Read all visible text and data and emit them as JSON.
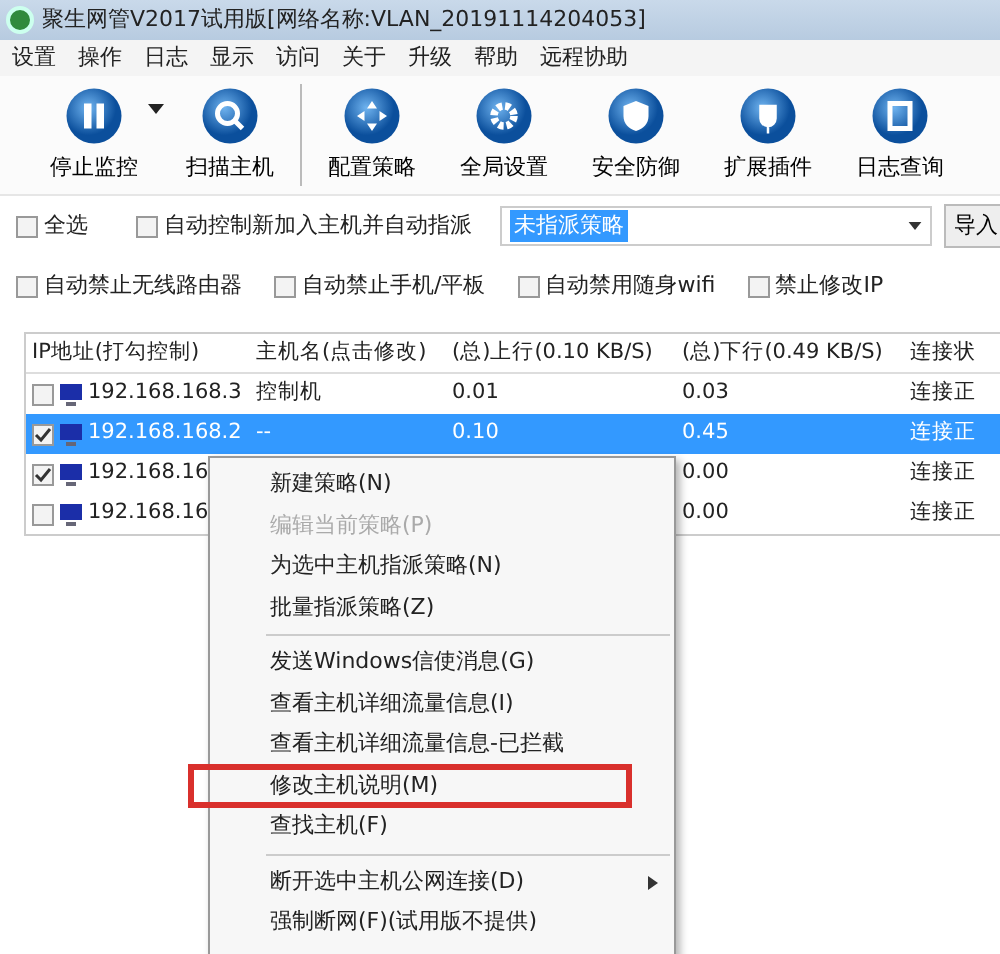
{
  "window": {
    "title": "聚生网管V2017试用版[网络名称:VLAN_20191114204053]"
  },
  "menu_bar": [
    "设置",
    "操作",
    "日志",
    "显示",
    "访问",
    "关于",
    "升级",
    "帮助",
    "远程协助"
  ],
  "toolbar": [
    {
      "label": "停止监控",
      "kind": "pause",
      "dropdown": true
    },
    {
      "label": "扫描主机",
      "kind": "search",
      "dropdown": false
    },
    {
      "label": "配置策略",
      "kind": "arrows",
      "dropdown": false
    },
    {
      "label": "全局设置",
      "kind": "gear",
      "dropdown": false
    },
    {
      "label": "安全防御",
      "kind": "shield",
      "dropdown": false
    },
    {
      "label": "扩展插件",
      "kind": "plug",
      "dropdown": false
    },
    {
      "label": "日志查询",
      "kind": "doc",
      "dropdown": false
    }
  ],
  "options_row_1": {
    "select_all": {
      "label": "全选",
      "checked": false
    },
    "auto_control": {
      "label": "自动控制新加入主机并自动指派",
      "checked": false
    },
    "policy_select": {
      "value": "未指派策略"
    },
    "import_button": "导入"
  },
  "options_row_2": [
    {
      "label": "自动禁止无线路由器",
      "checked": false
    },
    {
      "label": "自动禁止手机/平板",
      "checked": false
    },
    {
      "label": "自动禁用随身wifi",
      "checked": false
    },
    {
      "label": "禁止修改IP",
      "checked": false
    }
  ],
  "table": {
    "columns": [
      "IP地址(打勾控制)",
      "主机名(点击修改)",
      "(总)上行(0.10 KB/S)",
      "(总)下行(0.49 KB/S)",
      "连接状"
    ],
    "rows": [
      {
        "checked": false,
        "selected": false,
        "ip": "192.168.168.3",
        "host": "控制机",
        "up": "0.01",
        "down": "0.03",
        "status": "连接正"
      },
      {
        "checked": true,
        "selected": true,
        "ip": "192.168.168.2",
        "host": "--",
        "up": "0.10",
        "down": "0.45",
        "status": "连接正"
      },
      {
        "checked": true,
        "selected": false,
        "ip": "192.168.16",
        "down": "0.00",
        "status": "连接正"
      },
      {
        "checked": false,
        "selected": false,
        "ip": "192.168.16",
        "down": "0.00",
        "status": "连接正"
      }
    ]
  },
  "context_menu": [
    {
      "kind": "item",
      "label": "新建策略(N)",
      "disabled": false,
      "highlighted": false,
      "submenu": false
    },
    {
      "kind": "item",
      "label": "编辑当前策略(P)",
      "disabled": true,
      "highlighted": false,
      "submenu": false
    },
    {
      "kind": "item",
      "label": "为选中主机指派策略(N)",
      "disabled": false,
      "highlighted": false,
      "submenu": false
    },
    {
      "kind": "item",
      "label": "批量指派策略(Z)",
      "disabled": false,
      "highlighted": false,
      "submenu": false
    },
    {
      "kind": "separator"
    },
    {
      "kind": "item",
      "label": "发送Windows信使消息(G)",
      "disabled": false,
      "highlighted": false,
      "submenu": false
    },
    {
      "kind": "item",
      "label": "查看主机详细流量信息(I)",
      "disabled": false,
      "highlighted": false,
      "submenu": false
    },
    {
      "kind": "item",
      "label": "查看主机详细流量信息-已拦截",
      "disabled": false,
      "highlighted": false,
      "submenu": false
    },
    {
      "kind": "item",
      "label": "修改主机说明(M)",
      "disabled": false,
      "highlighted": true,
      "submenu": false
    },
    {
      "kind": "item",
      "label": "查找主机(F)",
      "disabled": false,
      "highlighted": false,
      "submenu": false
    },
    {
      "kind": "separator"
    },
    {
      "kind": "item",
      "label": "断开选中主机公网连接(D)",
      "disabled": false,
      "highlighted": false,
      "submenu": true
    },
    {
      "kind": "item",
      "label": "强制断网(F)(试用版不提供)",
      "disabled": false,
      "highlighted": false,
      "submenu": false
    }
  ]
}
